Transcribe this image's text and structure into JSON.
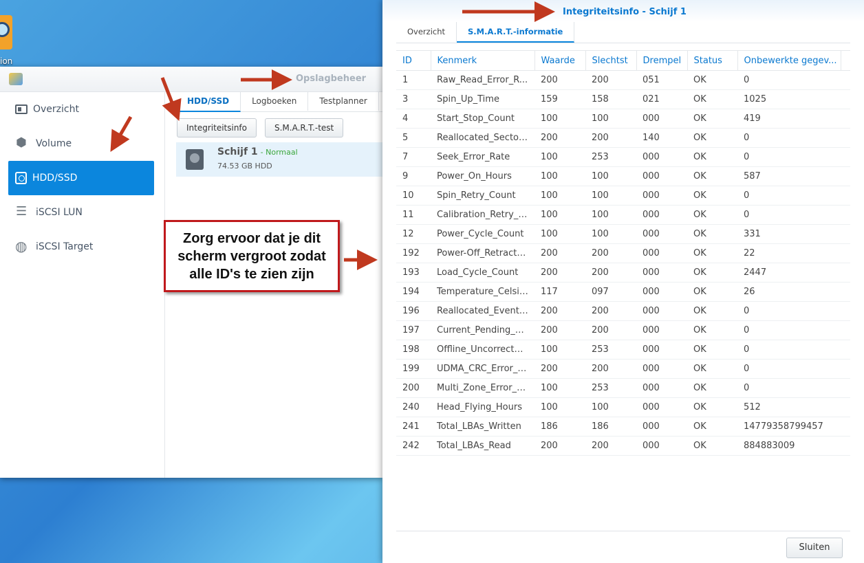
{
  "desktop": {
    "icon_label": "ion"
  },
  "storage_manager": {
    "title": "Opslagbeheer",
    "sidebar": [
      {
        "label": "Overzicht",
        "icon": "overview-card-icon"
      },
      {
        "label": "Volume",
        "icon": "cubes-icon"
      },
      {
        "label": "HDD/SSD",
        "icon": "hard-disk-icon",
        "active": true
      },
      {
        "label": "iSCSI LUN",
        "icon": "database-icon"
      },
      {
        "label": "iSCSI Target",
        "icon": "globe-icon"
      }
    ],
    "tabs": [
      "HDD/SSD",
      "Logboeken",
      "Testplanner"
    ],
    "buttons": {
      "integrity": "Integriteitsinfo",
      "smart_test": "S.M.A.R.T.-test"
    },
    "disk": {
      "name": "Schijf 1",
      "status": "- Normaal",
      "size": "74.53 GB HDD"
    }
  },
  "dialog": {
    "title": "Integriteitsinfo - Schijf 1",
    "tabs": [
      "Overzicht",
      "S.M.A.R.T.-informatie"
    ],
    "columns": [
      "ID",
      "Kenmerk",
      "Waarde",
      "Slechtst",
      "Drempel",
      "Status",
      "Onbewerkte gegev..."
    ],
    "rows": [
      [
        "1",
        "Raw_Read_Error_R...",
        "200",
        "200",
        "051",
        "OK",
        "0"
      ],
      [
        "3",
        "Spin_Up_Time",
        "159",
        "158",
        "021",
        "OK",
        "1025"
      ],
      [
        "4",
        "Start_Stop_Count",
        "100",
        "100",
        "000",
        "OK",
        "419"
      ],
      [
        "5",
        "Reallocated_Sector_...",
        "200",
        "200",
        "140",
        "OK",
        "0"
      ],
      [
        "7",
        "Seek_Error_Rate",
        "100",
        "253",
        "000",
        "OK",
        "0"
      ],
      [
        "9",
        "Power_On_Hours",
        "100",
        "100",
        "000",
        "OK",
        "587"
      ],
      [
        "10",
        "Spin_Retry_Count",
        "100",
        "100",
        "000",
        "OK",
        "0"
      ],
      [
        "11",
        "Calibration_Retry_C...",
        "100",
        "100",
        "000",
        "OK",
        "0"
      ],
      [
        "12",
        "Power_Cycle_Count",
        "100",
        "100",
        "000",
        "OK",
        "331"
      ],
      [
        "192",
        "Power-Off_Retract_...",
        "200",
        "200",
        "000",
        "OK",
        "22"
      ],
      [
        "193",
        "Load_Cycle_Count",
        "200",
        "200",
        "000",
        "OK",
        "2447"
      ],
      [
        "194",
        "Temperature_Celsius",
        "117",
        "097",
        "000",
        "OK",
        "26"
      ],
      [
        "196",
        "Reallocated_Event_...",
        "200",
        "200",
        "000",
        "OK",
        "0"
      ],
      [
        "197",
        "Current_Pending_S...",
        "200",
        "200",
        "000",
        "OK",
        "0"
      ],
      [
        "198",
        "Offline_Uncorrectable",
        "100",
        "253",
        "000",
        "OK",
        "0"
      ],
      [
        "199",
        "UDMA_CRC_Error_C...",
        "200",
        "200",
        "000",
        "OK",
        "0"
      ],
      [
        "200",
        "Multi_Zone_Error_R...",
        "100",
        "253",
        "000",
        "OK",
        "0"
      ],
      [
        "240",
        "Head_Flying_Hours",
        "100",
        "100",
        "000",
        "OK",
        "512"
      ],
      [
        "241",
        "Total_LBAs_Written",
        "186",
        "186",
        "000",
        "OK",
        "14779358799457"
      ],
      [
        "242",
        "Total_LBAs_Read",
        "200",
        "200",
        "000",
        "OK",
        "884883009"
      ]
    ],
    "close_label": "Sluiten"
  },
  "annotation": {
    "callout_text": "Zorg ervoor dat je dit scherm vergroot zodat alle ID's te zien zijn",
    "arrow_color": "#c0391f"
  }
}
